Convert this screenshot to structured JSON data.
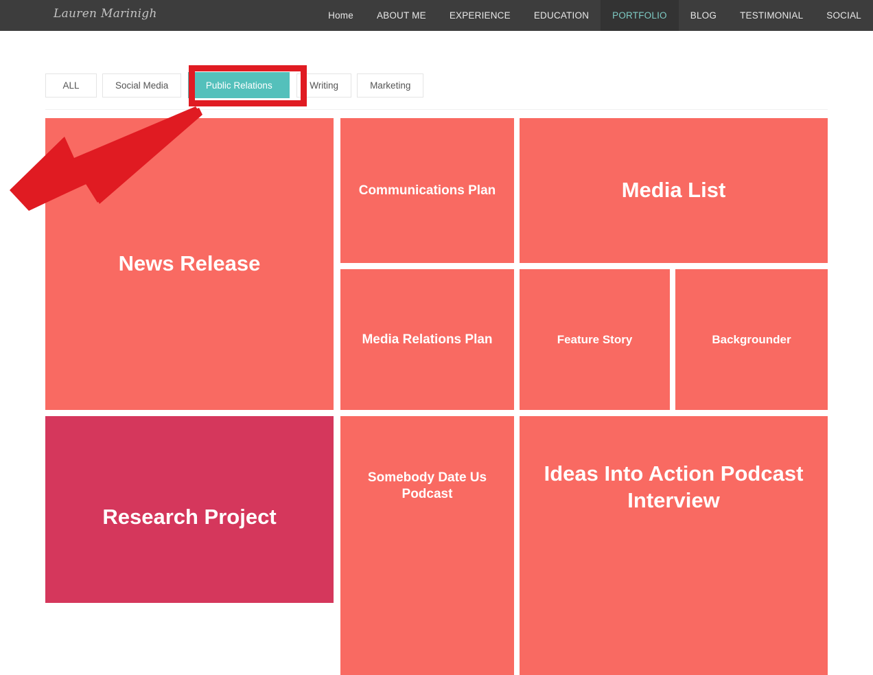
{
  "site": {
    "brand": "Lauren Marinigh"
  },
  "nav": {
    "items": [
      {
        "label": "Home",
        "active": false
      },
      {
        "label": "ABOUT ME",
        "active": false
      },
      {
        "label": "EXPERIENCE",
        "active": false
      },
      {
        "label": "EDUCATION",
        "active": false
      },
      {
        "label": "PORTFOLIO",
        "active": true
      },
      {
        "label": "BLOG",
        "active": false
      },
      {
        "label": "TESTIMONIAL",
        "active": false
      },
      {
        "label": "SOCIAL",
        "active": false
      }
    ],
    "active_color": "#7ecbc4",
    "background": "#3d3d3d"
  },
  "filters": {
    "items": [
      {
        "label": "ALL",
        "active": false
      },
      {
        "label": "Social Media",
        "active": false
      },
      {
        "label": "Public Relations",
        "active": true
      },
      {
        "label": "Writing",
        "active": false
      },
      {
        "label": "Marketing",
        "active": false
      }
    ],
    "active_color": "#54c0bb"
  },
  "portfolio": {
    "tiles": [
      {
        "title": "News Release",
        "color": "#f96a62"
      },
      {
        "title": "Communications Plan",
        "color": "#f96a62"
      },
      {
        "title": "Media List",
        "color": "#f96a62"
      },
      {
        "title": "Media Relations Plan",
        "color": "#f96a62"
      },
      {
        "title": "Feature Story",
        "color": "#f96a62"
      },
      {
        "title": "Backgrounder",
        "color": "#f96a62"
      },
      {
        "title": "Research Project",
        "color": "#d5375c"
      },
      {
        "title": "Somebody Date Us Podcast",
        "color": "#f96a62"
      },
      {
        "title": "Ideas Into Action Podcast Interview",
        "color": "#f96a62"
      }
    ]
  },
  "annotations": {
    "highlight_color": "#e01b22",
    "arrow_color": "#e01b22",
    "target": "Public Relations"
  }
}
